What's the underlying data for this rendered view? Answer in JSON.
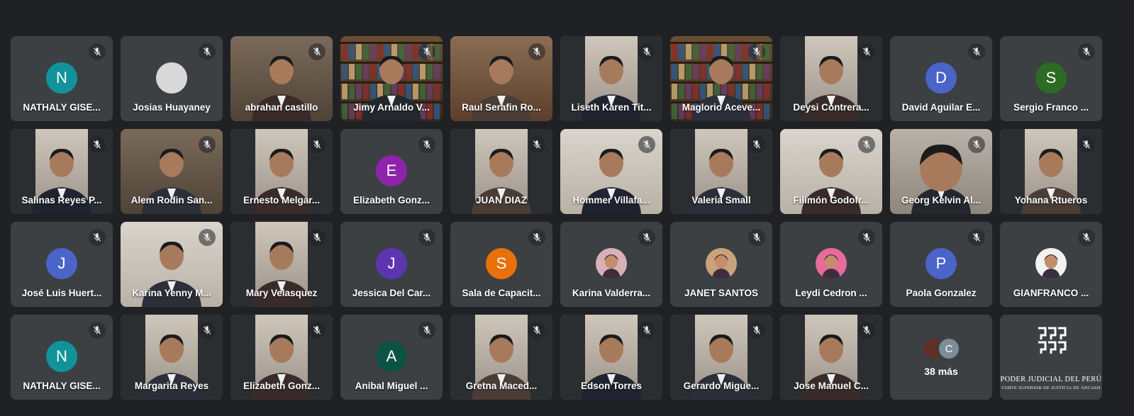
{
  "tiles": [
    {
      "name": "NATHALY GISE...",
      "kind": "avatar",
      "initial": "N",
      "color": "#12939b"
    },
    {
      "name": "Josias Huayaney",
      "kind": "avatar",
      "initial": "",
      "color": "#d8d8d8"
    },
    {
      "name": "abrahan castillo",
      "kind": "video",
      "scene": "office"
    },
    {
      "name": "Jimy Arnaldo V...",
      "kind": "video",
      "scene": "bookshelf"
    },
    {
      "name": "Raul Serafin Ro...",
      "kind": "video",
      "scene": "judge"
    },
    {
      "name": "Liseth Karen Tit...",
      "kind": "video",
      "scene": "portrait"
    },
    {
      "name": "Maglorio Aceve...",
      "kind": "video",
      "scene": "bookshelf"
    },
    {
      "name": "Deysi Contrera...",
      "kind": "video",
      "scene": "portrait"
    },
    {
      "name": "David Aguilar E...",
      "kind": "avatar",
      "initial": "D",
      "color": "#4a64c8"
    },
    {
      "name": "Sergio Franco ...",
      "kind": "avatar",
      "initial": "S",
      "color": "#2c6b23"
    },
    {
      "name": "Salinas Reyes P...",
      "kind": "video",
      "scene": "portrait"
    },
    {
      "name": "Alem Rodin San...",
      "kind": "video",
      "scene": "office"
    },
    {
      "name": "Ernesto Melgar...",
      "kind": "video",
      "scene": "portrait"
    },
    {
      "name": "Elizabeth Gonz...",
      "kind": "avatar",
      "initial": "E",
      "color": "#8e24aa"
    },
    {
      "name": "JUAN DIAZ",
      "kind": "video",
      "scene": "portrait"
    },
    {
      "name": "Hommer Villafa...",
      "kind": "video",
      "scene": "wall"
    },
    {
      "name": "Valeria Small",
      "kind": "video",
      "scene": "portrait"
    },
    {
      "name": "Filimón Godofr...",
      "kind": "video",
      "scene": "wall"
    },
    {
      "name": "Georg Kelvin Al...",
      "kind": "video",
      "scene": "closeup"
    },
    {
      "name": "Yohana Rtueros",
      "kind": "video",
      "scene": "portrait"
    },
    {
      "name": "José Luis Huert...",
      "kind": "avatar",
      "initial": "J",
      "color": "#4a64c8"
    },
    {
      "name": "Karina Yenny M...",
      "kind": "video",
      "scene": "wall"
    },
    {
      "name": "Mary Velasquez",
      "kind": "video",
      "scene": "portrait"
    },
    {
      "name": "Jessica Del Car...",
      "kind": "avatar",
      "initial": "J",
      "color": "#5e35b1"
    },
    {
      "name": "Sala de Capacit...",
      "kind": "avatar",
      "initial": "S",
      "color": "#e8710a"
    },
    {
      "name": "Karina Valderra...",
      "kind": "photo",
      "tone": "#d9b0b8"
    },
    {
      "name": "JANET SANTOS",
      "kind": "photo",
      "tone": "#c9a27c"
    },
    {
      "name": "Leydi Cedron ...",
      "kind": "photo",
      "tone": "#e76b9b"
    },
    {
      "name": "Paola Gonzalez",
      "kind": "avatar",
      "initial": "P",
      "color": "#4a64c8"
    },
    {
      "name": "GIANFRANCO ...",
      "kind": "photo",
      "tone": "#f2f2f2"
    },
    {
      "name": "NATHALY GISE...",
      "kind": "avatar",
      "initial": "N",
      "color": "#12939b"
    },
    {
      "name": "Margarita Reyes",
      "kind": "video",
      "scene": "portrait"
    },
    {
      "name": "Elizabeth Gonz...",
      "kind": "video",
      "scene": "portrait"
    },
    {
      "name": "Anibal Miguel ...",
      "kind": "avatar",
      "initial": "A",
      "color": "#0b5345"
    },
    {
      "name": "Gretna Maced...",
      "kind": "video",
      "scene": "portrait"
    },
    {
      "name": "Edson Torres",
      "kind": "video",
      "scene": "portrait"
    },
    {
      "name": "Gerardo Migue...",
      "kind": "video",
      "scene": "portrait"
    },
    {
      "name": "Jose Manuel C...",
      "kind": "video",
      "scene": "portrait"
    },
    {
      "name": "",
      "kind": "more",
      "more_label": "38 más",
      "more_initial": "C"
    },
    {
      "name": "",
      "kind": "logo",
      "logo_line1": "PODER JUDICIAL DEL PERÚ",
      "logo_line2": "CORTE SUPERIOR DE JUSTICIA DE ÁNCASH"
    }
  ]
}
